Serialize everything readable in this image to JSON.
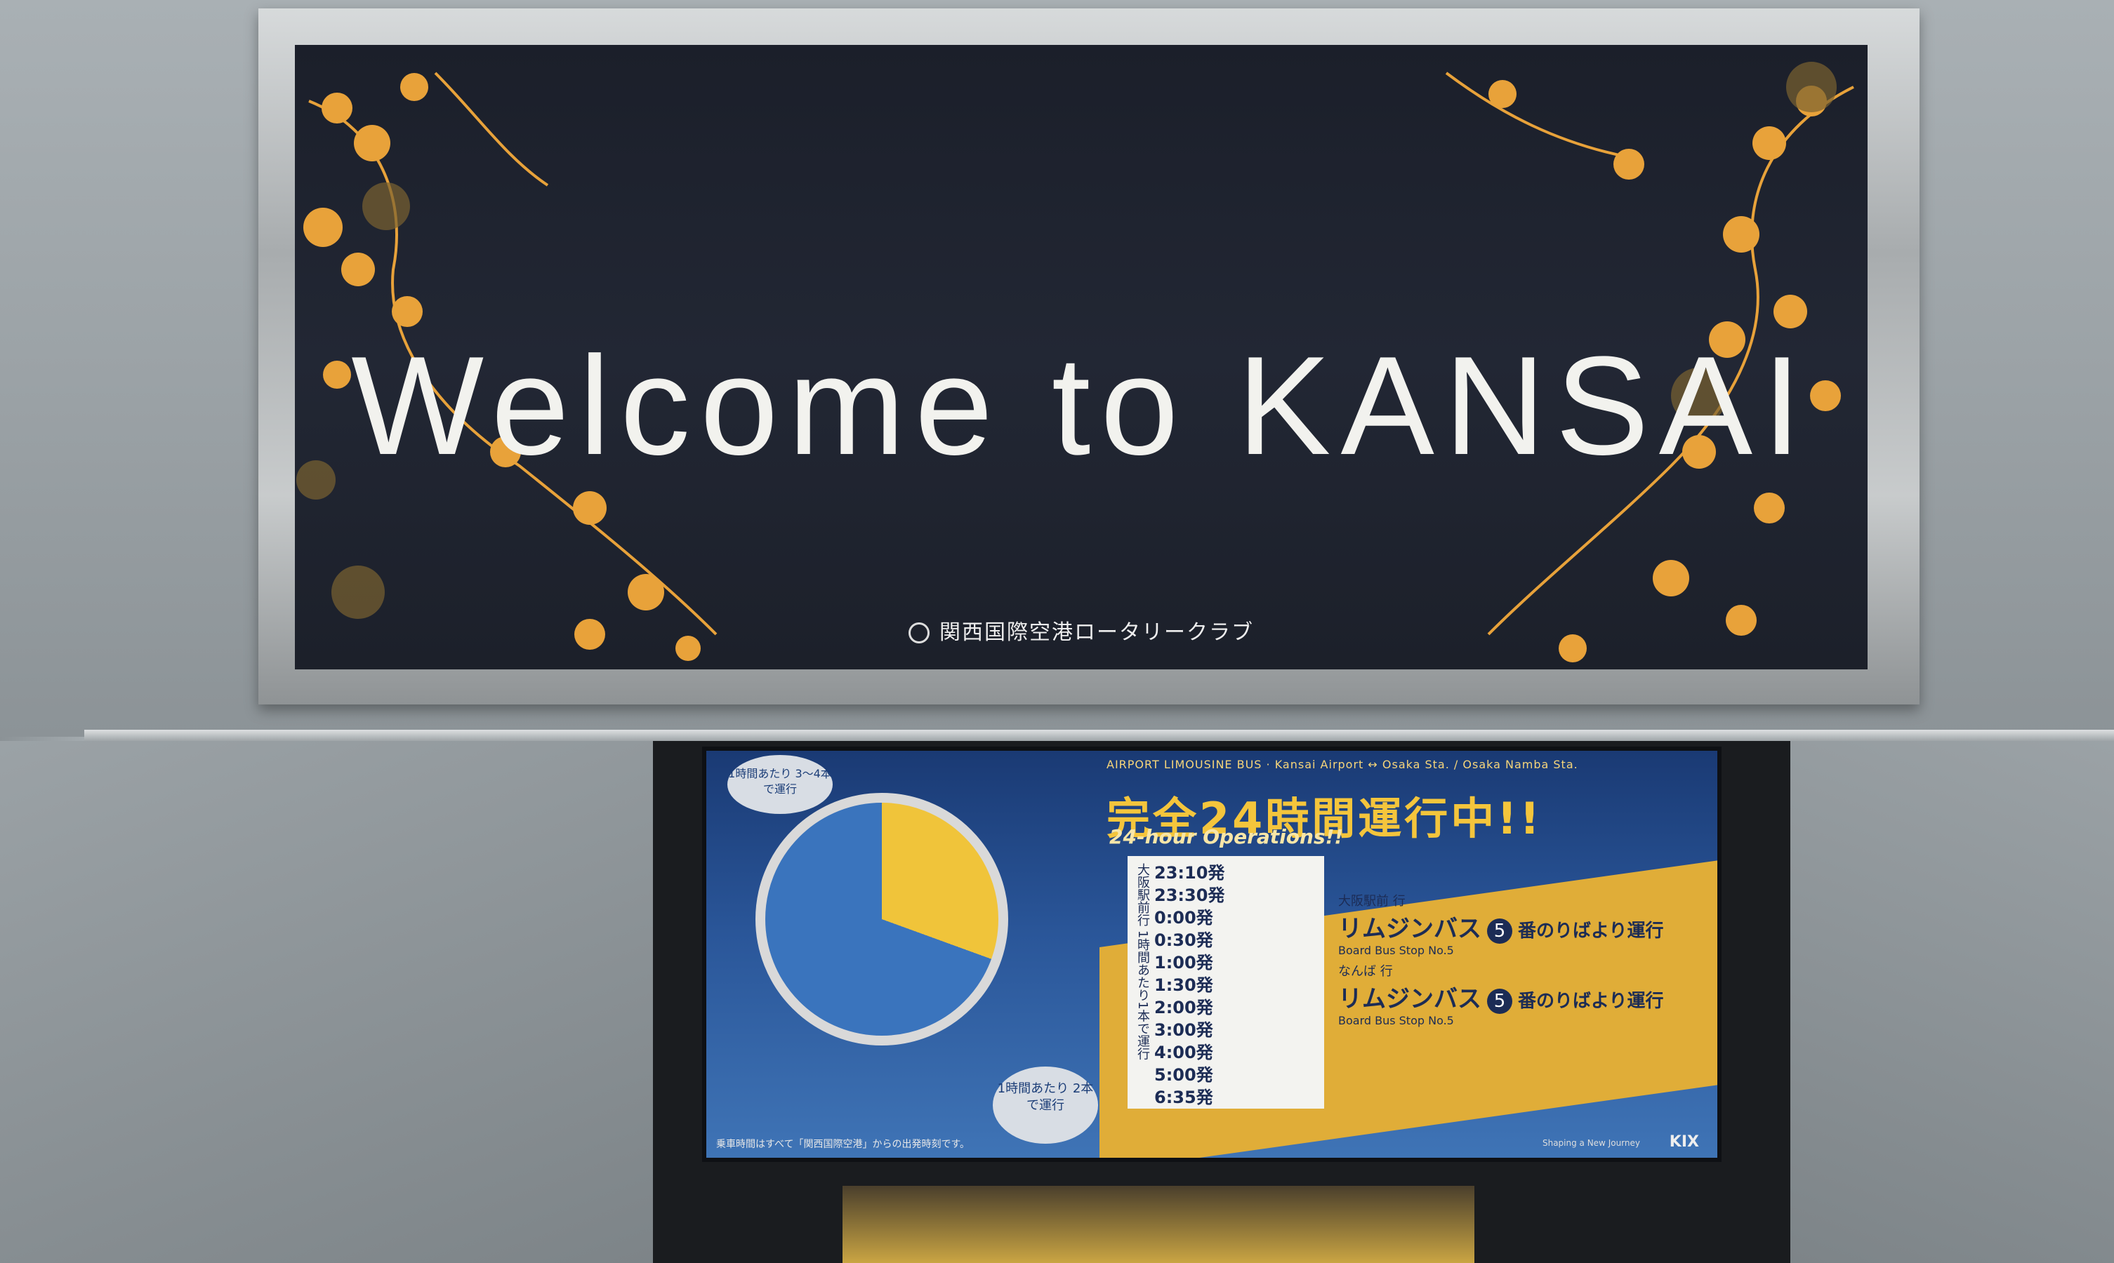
{
  "scene": {
    "description": "Photo of an overhead welcome sign at Kansai International Airport above an escalator with a limousine bus poster below",
    "sign": {
      "title": "Welcome to KANSAI",
      "sponsor": "関西国際空港ロータリークラブ"
    },
    "poster": {
      "top_strip": "AIRPORT LIMOUSINE BUS · Kansai Airport ↔ Osaka Sta. / Osaka Namba Sta.",
      "headline_jp": "完全24時間運行中!!",
      "headline_en": "24-hour Operations!!",
      "clock_badge_top": "1時間あたり 3〜4本で運行",
      "clock_badge_bottom": "1時間あたり 2本で運行",
      "side_label": "大阪駅前行 1時間あたり1本で運行",
      "timetable": [
        "23:10発",
        "23:30発",
        "0:00発",
        "0:30発",
        "1:00発",
        "1:30発",
        "2:00発",
        "3:00発",
        "4:00発",
        "5:00発",
        "6:35発"
      ],
      "routes": [
        {
          "dest": "大阪駅前 行",
          "name": "リムジンバス",
          "number": "5",
          "board": "番のりばより運行",
          "en": "Board Bus Stop No.5"
        },
        {
          "dest": "なんば 行",
          "name": "リムジンバス",
          "number": "5",
          "board": "番のりばより運行",
          "en": "Board Bus Stop No.5"
        }
      ],
      "footer": "乗車時間はすべて「関西国際空港」からの出発時刻です。",
      "tagline": "Shaping a New Journey",
      "logo": "KIX"
    },
    "colors": {
      "board": "#1f2430",
      "blossom": "#e8a23a",
      "frame": "#b6babb",
      "poster_blue": "#2a5699",
      "poster_yellow": "#e0ad38"
    }
  }
}
